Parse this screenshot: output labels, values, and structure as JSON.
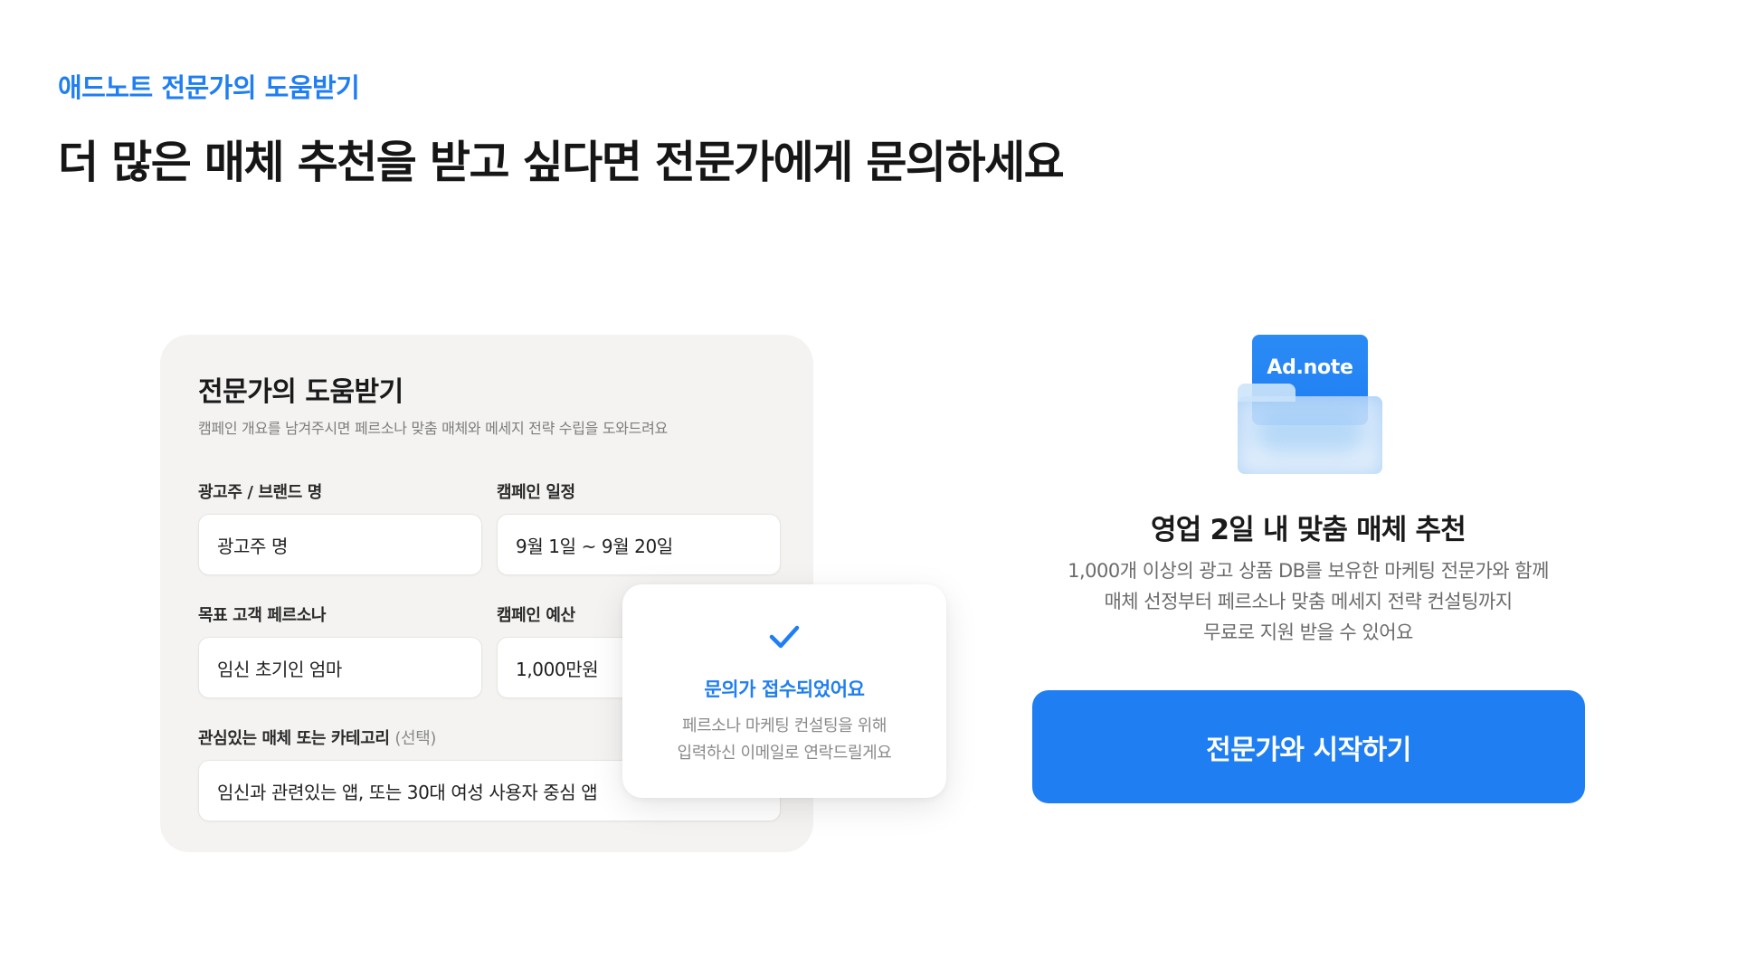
{
  "header": {
    "eyebrow": "애드노트 전문가의 도움받기",
    "headline": "더 많은 매체 추천을 받고 싶다면 전문가에게 문의하세요"
  },
  "form": {
    "title": "전문가의 도움받기",
    "description": "캠페인 개요를 남겨주시면 페르소나 맞춤 매체와 메세지 전략 수립을 도와드려요",
    "fields": [
      {
        "label": "광고주 / 브랜드 명",
        "value": "광고주 명"
      },
      {
        "label": "캠페인 일정",
        "value": "9월 1일 ~ 9월 20일"
      },
      {
        "label": "목표 고객 페르소나",
        "value": "임신 초기인 엄마"
      },
      {
        "label": "캠페인 예산",
        "value": "1,000만원"
      },
      {
        "label": "관심있는 매체 또는 카테고리",
        "optional": "(선택)",
        "value": "임신과 관련있는 앱, 또는 30대 여성 사용자 중심 앱"
      }
    ]
  },
  "toast": {
    "icon": "check-icon",
    "title": "문의가 접수되었어요",
    "body_line1": "페르소나 마케팅 컨설팅을 위해",
    "body_line2": "입력하신 이메일로 연락드릴게요"
  },
  "promo": {
    "logo_text": "Ad.note",
    "title": "영업 2일 내 맞춤 매체 추천",
    "desc_line1": "1,000개 이상의 광고 상품 DB를 보유한 마케팅 전문가와 함께",
    "desc_line2": "매체 선정부터 페르소나 맞춤 메세지 전략 컨설팅까지",
    "desc_line3": "무료로 지원 받을 수 있어요",
    "cta_label": "전문가와 시작하기"
  },
  "colors": {
    "accent": "#1f7ef2",
    "card_bg": "#f4f3f1",
    "text": "#1a1a1a"
  }
}
